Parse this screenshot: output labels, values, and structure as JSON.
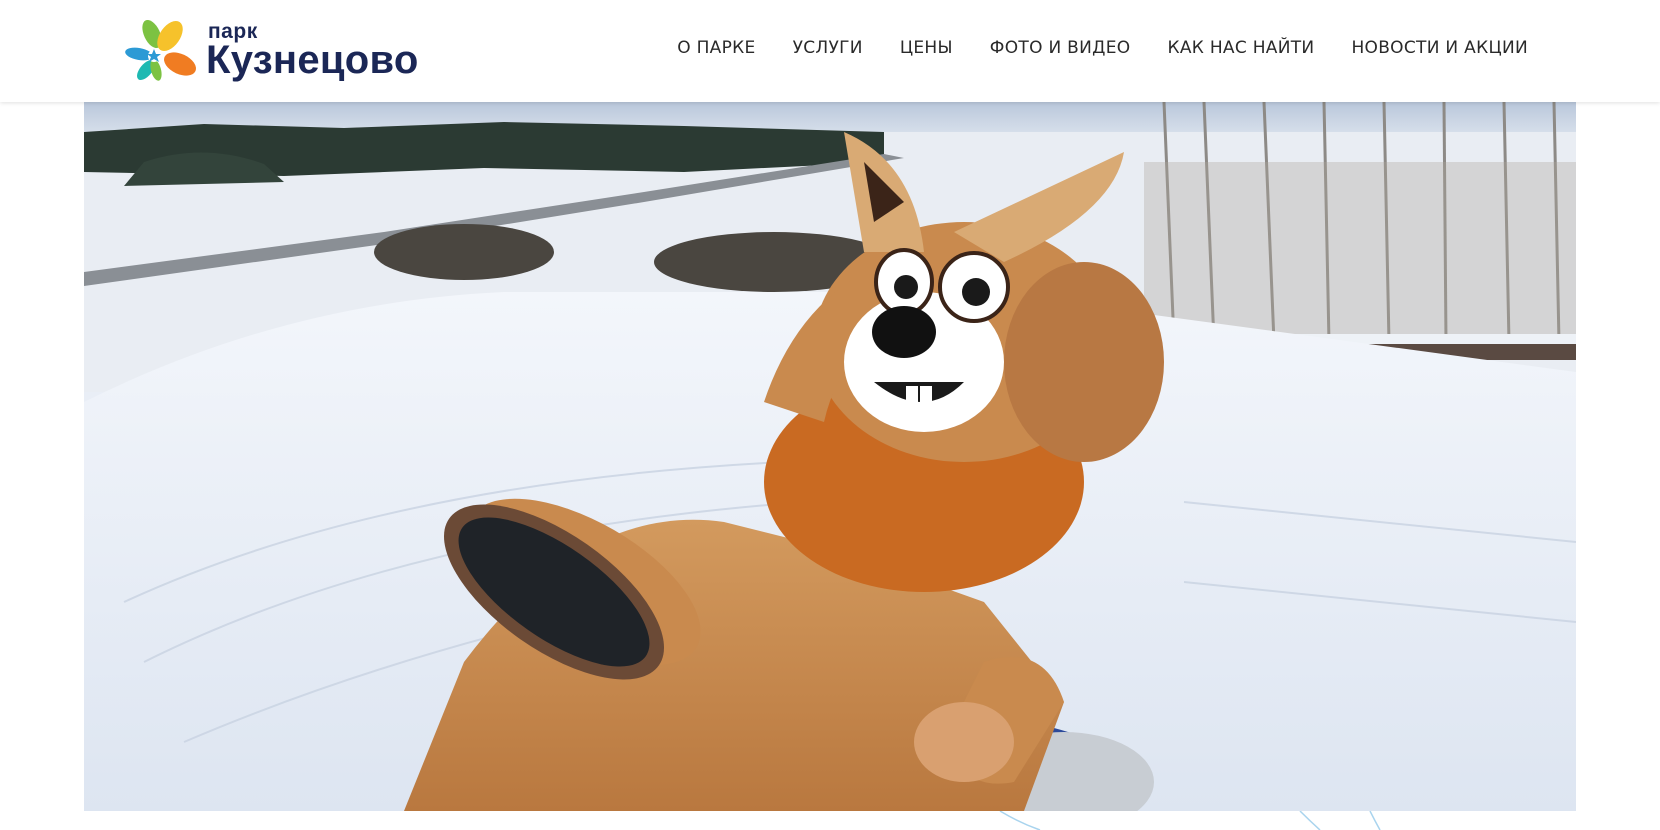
{
  "logo": {
    "small_text": "парк",
    "big_text": "Кузнецово"
  },
  "nav": {
    "items": [
      {
        "label": "О ПАРКЕ"
      },
      {
        "label": "УСЛУГИ"
      },
      {
        "label": "ЦЕНЫ"
      },
      {
        "label": "ФОТО И ВИДЕО"
      },
      {
        "label": "КАК НАС НАЙТИ"
      },
      {
        "label": "НОВОСТИ И АКЦИИ"
      }
    ]
  },
  "hero": {
    "image": "winter-snow-slope-with-squirrel-mascot-on-tube"
  },
  "colors": {
    "brand_dark": "#1b2756",
    "petal_yellow": "#f6c22b",
    "petal_orange": "#f07c22",
    "petal_green": "#7cc242",
    "petal_blue": "#2c9ad5",
    "petal_teal": "#1db9b2"
  }
}
